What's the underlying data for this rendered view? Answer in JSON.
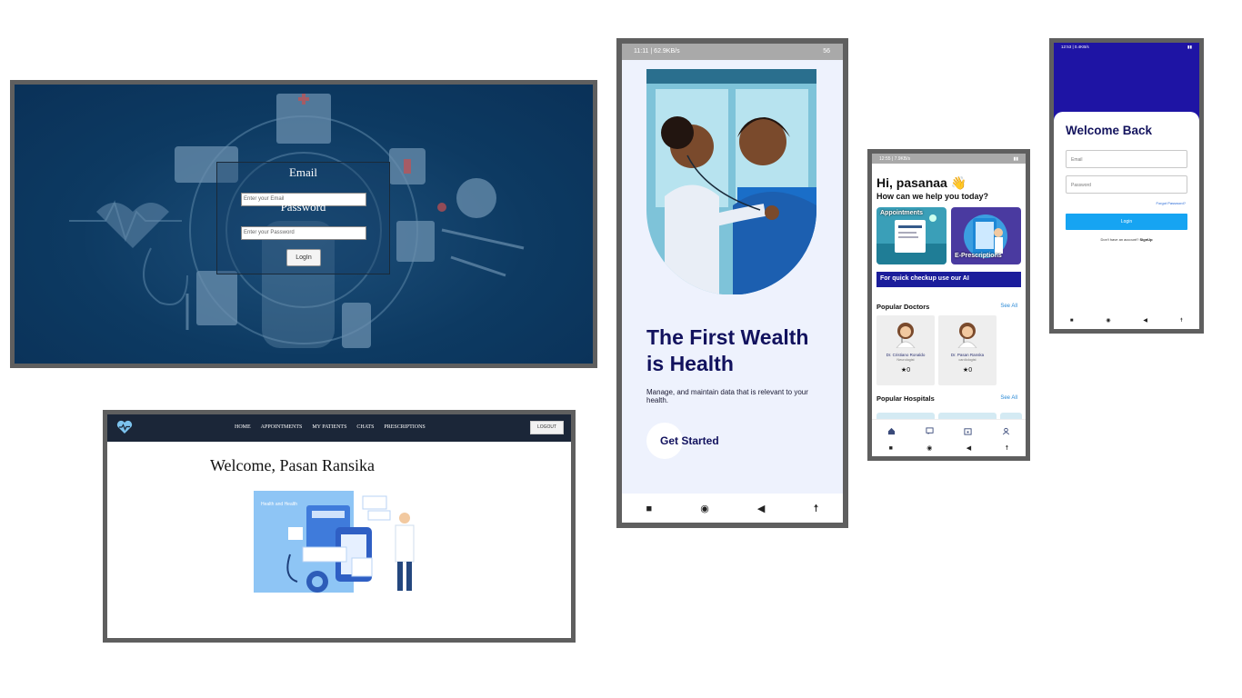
{
  "web_login": {
    "email_label": "Email",
    "email_placeholder": "Enter your Email",
    "password_label": "Password",
    "password_placeholder": "Enter your Password",
    "login_button": "LogIn"
  },
  "web_dashboard": {
    "nav_links": [
      "HOME",
      "APPOINTMENTS",
      "MY PATIENTS",
      "CHATS",
      "PRESCRIPTIONS"
    ],
    "logout_button": "LOGOUT",
    "welcome_text": "Welcome, Pasan Ransika",
    "illustration_text": "Health and Health"
  },
  "onboarding": {
    "status_time": "11:11 | 62.9KB/s",
    "status_right": "56",
    "title": "The First Wealth is Health",
    "subtitle": "Manage, and maintain data that is relevant to your health.",
    "cta": "Get Started"
  },
  "home": {
    "status_time": "12:55 | 7.9KB/s",
    "greeting": "Hi, pasanaa 👋",
    "help_text": "How can we help you today?",
    "cards": [
      {
        "label": "Appointments"
      },
      {
        "label": "E-Prescriptions"
      }
    ],
    "ai_banner": "For quick checkup use our AI",
    "popular_doctors_title": "Popular Doctors",
    "see_all_doctors": "See All",
    "doctors": [
      {
        "name": "Dr. Cristiano Ronaldo",
        "specialty": "Neurologist",
        "rating": "0"
      },
      {
        "name": "Dr. Pasan Ranska",
        "specialty": "cardiologist",
        "rating": "0"
      }
    ],
    "popular_hospitals_title": "Popular Hospitals",
    "see_all_hospitals": "See All"
  },
  "mobile_login": {
    "status_time": "12:53 | 0.4KB/s",
    "title": "Welcome Back",
    "email_placeholder": "Email",
    "password_placeholder": "Password",
    "forgot_password": "Forgot Password?",
    "login_button": "Login",
    "signup_prompt": "Don't have an account?",
    "signup_link": "SignUp"
  },
  "colors": {
    "navy_text": "#12125e",
    "login_blue": "#16a4f2",
    "header_indigo": "#1e14a4",
    "nav_dark": "#1b2638",
    "ai_banner": "#1b1d9b"
  }
}
